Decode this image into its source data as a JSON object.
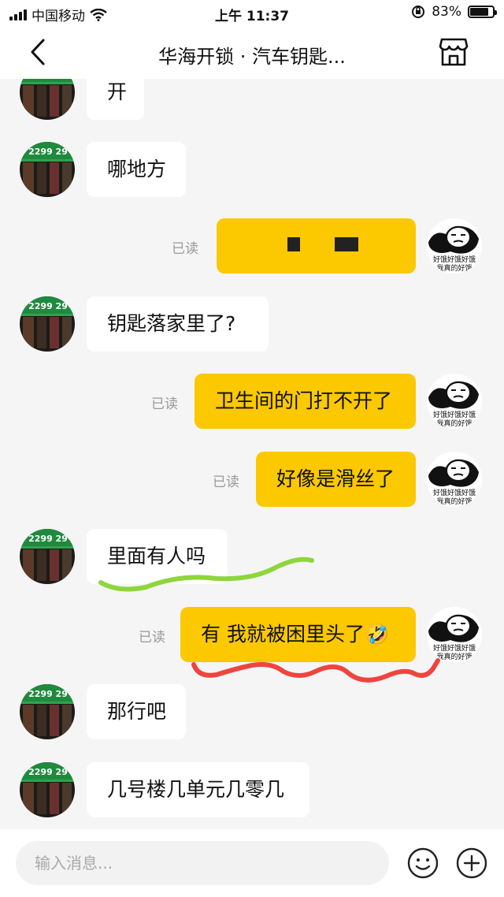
{
  "status_bar": {
    "carrier": "中国移动",
    "time": "上午 11:37",
    "battery_text": "83%",
    "battery_level": 0.83,
    "icons": [
      "signal-icon",
      "wifi-icon",
      "orientation-lock-icon",
      "battery-icon"
    ]
  },
  "nav": {
    "title": "华海开锁 · 汽车钥匙...",
    "back_icon": "back-arrow-icon",
    "store_icon": "store-icon"
  },
  "messages": [
    {
      "side": "in",
      "text": "开"
    },
    {
      "side": "in",
      "text": "哪地方"
    },
    {
      "side": "out",
      "text": "",
      "redacted": true,
      "status": "已读"
    },
    {
      "side": "in",
      "text": "钥匙落家里了?"
    },
    {
      "side": "out",
      "text": "卫生间的门打不开了",
      "status": "已读"
    },
    {
      "side": "out",
      "text": "好像是滑丝了",
      "status": "已读"
    },
    {
      "side": "in",
      "text": "里面有人吗"
    },
    {
      "side": "out",
      "text": "有  我就被困里头了🤣",
      "status": "已读"
    },
    {
      "side": "in",
      "text": "那行吧"
    },
    {
      "side": "in",
      "text": "几号楼几单元几零几"
    }
  ],
  "avatar_in": {
    "sign_text": "2299 29"
  },
  "avatar_out": {
    "caption_line1": "好饿好饿好饿",
    "caption_line2": "我真的好饿"
  },
  "annotations": {
    "green_stroke": "#8ed63c",
    "red_stroke": "#f0443f"
  },
  "input": {
    "placeholder": "输入消息...",
    "value": ""
  },
  "input_icons": [
    "emoji-icon",
    "plus-icon"
  ],
  "colors": {
    "out_bubble": "#fcc800",
    "in_bubble": "#ffffff",
    "background": "#f5f5f5"
  }
}
